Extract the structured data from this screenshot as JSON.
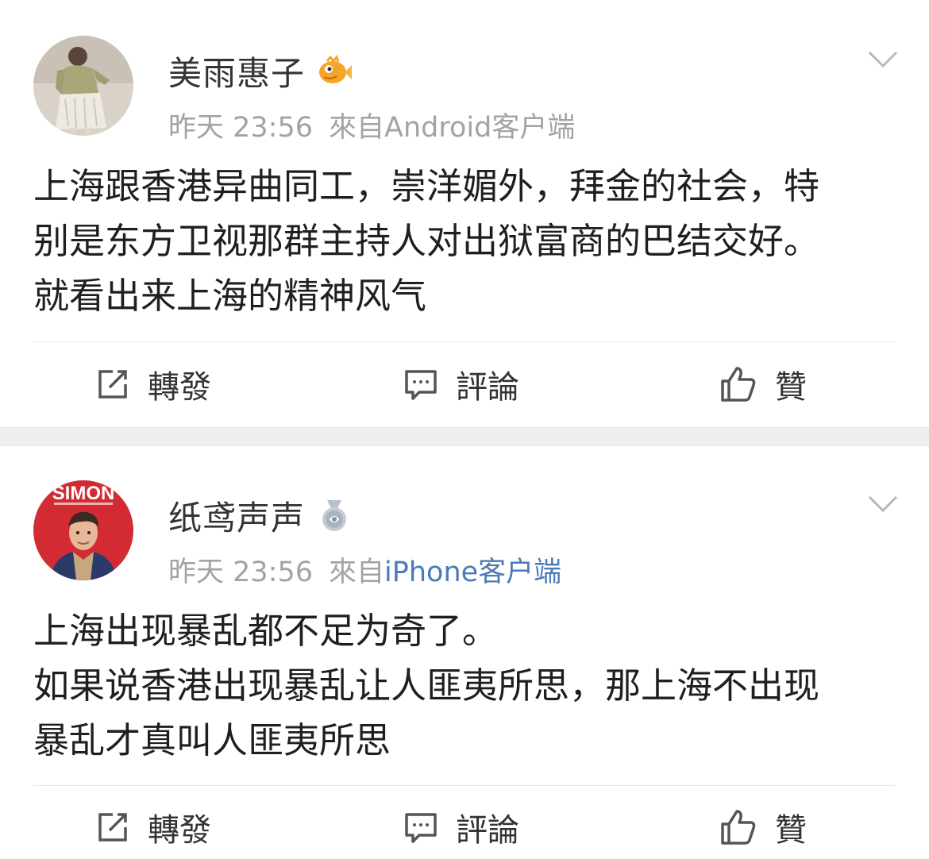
{
  "posts": [
    {
      "username": "美雨惠子",
      "time": "昨天 23:56",
      "source_prefix": "來自",
      "source_client": "Android客户端",
      "content_lines": [
        "上海跟香港异曲同工，崇洋媚外，拜金的社会，特",
        "别是东方卫视那群主持人对出狱富商的巴结交好。",
        "就看出来上海的精神风气"
      ],
      "actions": {
        "repost": "轉發",
        "comment": "評論",
        "like": "贊"
      }
    },
    {
      "username": "纸鸢声声",
      "time": "昨天 23:56",
      "source_prefix": "來自",
      "source_client": "iPhone客户端",
      "avatar_text": "SIMON",
      "content_lines": [
        "上海出现暴乱都不足为奇了。",
        "如果说香港出现暴乱让人匪夷所思，那上海不出现",
        "暴乱才真叫人匪夷所思"
      ],
      "actions": {
        "repost": "轉發",
        "comment": "評論",
        "like": "贊"
      }
    }
  ],
  "colors": {
    "meta_gray": "#a3a3a3",
    "link_blue": "#4a7ab8",
    "separator": "#efefef",
    "text": "#1f1f1f"
  },
  "icons": [
    "repost-icon",
    "comment-icon",
    "thumbs-up-icon",
    "chevron-down-icon",
    "fish-badge-icon",
    "medal-badge-icon"
  ]
}
